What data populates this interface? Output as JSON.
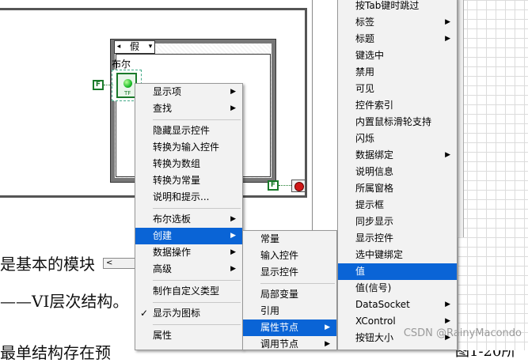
{
  "diagram": {
    "case_selector_value": "假",
    "case_left_arrow": "◂",
    "case_right_arrow": "▾",
    "bool_label": "布尔",
    "bool_tf": "TF",
    "false_const": "F",
    "hscroll_arrow": "<"
  },
  "document": {
    "line1": "是基本的模块",
    "line2": "——VI层次结构。",
    "line3": "最单结构存在预",
    "line3b": "图1-20所"
  },
  "menu1": {
    "items": [
      {
        "label": "显示项",
        "arrow": "▶"
      },
      {
        "label": "查找",
        "arrow": "▶"
      },
      {
        "label": "隐藏显示控件"
      },
      {
        "label": "转换为输入控件"
      },
      {
        "label": "转换为数组"
      },
      {
        "label": "转换为常量"
      },
      {
        "label": "说明和提示..."
      },
      {
        "label": "布尔选板",
        "arrow": "▶"
      },
      {
        "label": "创建",
        "arrow": "▶"
      },
      {
        "label": "数据操作",
        "arrow": "▶"
      },
      {
        "label": "高级",
        "arrow": "▶"
      },
      {
        "label": "制作自定义类型"
      },
      {
        "label": "显示为图标",
        "check": "✓"
      },
      {
        "label": "属性"
      }
    ]
  },
  "menu2": {
    "items": [
      {
        "label": "常量"
      },
      {
        "label": "输入控件"
      },
      {
        "label": "显示控件"
      },
      {
        "label": "局部变量"
      },
      {
        "label": "引用"
      },
      {
        "label": "属性节点",
        "arrow": "▶"
      },
      {
        "label": "调用节点",
        "arrow": "▶"
      }
    ]
  },
  "menu3": {
    "items": [
      {
        "label": "按Tab键时跳过"
      },
      {
        "label": "标签",
        "arrow": "▶"
      },
      {
        "label": "标题",
        "arrow": "▶"
      },
      {
        "label": "键选中"
      },
      {
        "label": "禁用"
      },
      {
        "label": "可见"
      },
      {
        "label": "控件索引"
      },
      {
        "label": "内置鼠标滑轮支持"
      },
      {
        "label": "闪烁"
      },
      {
        "label": "数据绑定",
        "arrow": "▶"
      },
      {
        "label": "说明信息"
      },
      {
        "label": "所属窗格"
      },
      {
        "label": "提示框"
      },
      {
        "label": "同步显示"
      },
      {
        "label": "显示控件"
      },
      {
        "label": "选中键绑定"
      },
      {
        "label": "值"
      },
      {
        "label": "值(信号)"
      },
      {
        "label": "DataSocket",
        "arrow": "▶"
      },
      {
        "label": "XControl",
        "arrow": "▶"
      },
      {
        "label": "按钮大小",
        "arrow": "▶"
      }
    ]
  },
  "watermark": "CSDN @RainyMacondo",
  "colors": {
    "menu_bg": "#f2f2f2",
    "menu_selected": "#0a64d6",
    "bool_green": "#1a7a2a",
    "stop_red": "#d01818"
  }
}
